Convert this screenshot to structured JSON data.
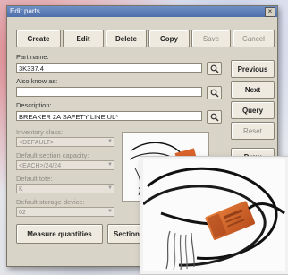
{
  "window": {
    "title": "Edit parts",
    "close_glyph": "×"
  },
  "toolbar": {
    "create_label": "Create",
    "edit_label": "Edit",
    "delete_label": "Delete",
    "copy_label": "Copy",
    "save_label": "Save",
    "cancel_label": "Cancel"
  },
  "side_buttons": {
    "previous_label": "Previous",
    "next_label": "Next",
    "query_label": "Query",
    "reset_label": "Reset",
    "draw_label": "Draw"
  },
  "form": {
    "part_name_label": "Part name:",
    "part_name_value": "3K337.4",
    "also_known_as_label": "Also know as:",
    "also_known_as_value": "",
    "description_label": "Description:",
    "description_value": "BREAKER 2A SAFETY LINE UL*",
    "inventory_class_label": "Inventory class:",
    "inventory_class_value": "<DEFAULT>",
    "default_section_capacity_label": "Default section capacity:",
    "default_section_capacity_value": "<EACH>/24/24",
    "default_tote_label": "Default tote:",
    "default_tote_value": "K",
    "default_storage_device_label": "Default storage device:",
    "default_storage_device_value": "02"
  },
  "bottom_buttons": {
    "measure_label": "Measure quantities",
    "section_label": "Section c"
  },
  "icons": {
    "search": "magnifier-icon",
    "dropdown": "chevron-down-icon"
  },
  "colors": {
    "titlebar": "#5676b2",
    "window_bg": "#d9d4c8",
    "sensor_orange": "#d9632a"
  }
}
